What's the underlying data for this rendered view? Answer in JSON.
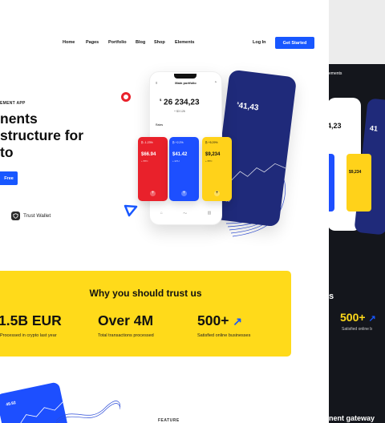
{
  "nav": {
    "items": [
      "Home",
      "Pages",
      "Portfolio",
      "Blog",
      "Shop",
      "Elements"
    ],
    "login": "Log In",
    "cta": "Get Started"
  },
  "hero": {
    "eyebrow": "EMENT APP",
    "headline_lines": [
      "nents",
      "structure for",
      "to"
    ],
    "button": "Free",
    "trust_label": "Trust Wallet"
  },
  "phone_white": {
    "title": "Main portfolio",
    "amount": "26 234,23",
    "currency": "$",
    "change": "+ $3 126",
    "tabs": [
      "Rates"
    ]
  },
  "phone_blue": {
    "amount": "41,43",
    "currency": "$",
    "label": "Ow"
  },
  "cards": [
    {
      "tag": "₿ -1.23%",
      "value": "$66.94",
      "sub": "+ BTC",
      "color": "#e9212b"
    },
    {
      "tag": "₿ +2.2%",
      "value": "$41.42",
      "sub": "+ ETH",
      "color": "#1d4fff"
    },
    {
      "tag": "₿ +5.29%",
      "value": "$9,234",
      "sub": "+ BTC",
      "color": "#ffd21a"
    }
  ],
  "trust_section": {
    "title": "Why you should trust us",
    "stats": [
      {
        "value": "1.5B EUR",
        "label": "Processed in crypto last year"
      },
      {
        "value": "Over 4M",
        "label": "Total transactions processed"
      },
      {
        "value": "500+",
        "label": "Satisfied online businesses"
      }
    ]
  },
  "dark_preview": {
    "nav": "ements",
    "amount": "4,23",
    "amount2": "41",
    "card_value": "$9,234",
    "section_suffix": "s",
    "stat": "500+",
    "stat_label": "Satisfied online b",
    "footer": "nent gateway"
  },
  "feature_label": "FEATURE",
  "bottom_phone": {
    "value": "49.92"
  }
}
